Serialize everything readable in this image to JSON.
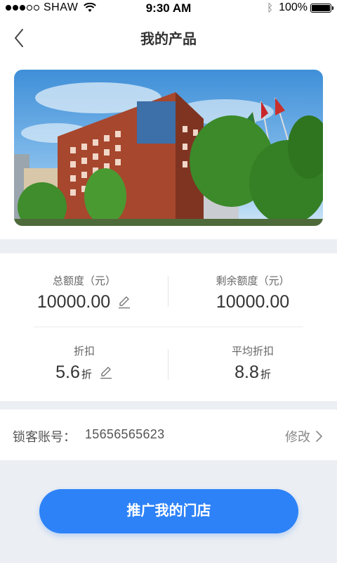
{
  "status_bar": {
    "carrier": "SHAW",
    "time": "9:30 AM",
    "battery": "100%"
  },
  "nav": {
    "title": "我的产品"
  },
  "stats": {
    "total_quota": {
      "label": "总额度（元）",
      "value": "10000.00"
    },
    "remaining_quota": {
      "label": "剩余额度（元）",
      "value": "10000.00"
    },
    "discount": {
      "label": "折扣",
      "value": "5.6",
      "unit": "折"
    },
    "avg_discount": {
      "label": "平均折扣",
      "value": "8.8",
      "unit": "折"
    }
  },
  "account": {
    "label": "锁客账号：",
    "number": "15656565623",
    "modify_label": "修改"
  },
  "promote_button": "推广我的门店",
  "colors": {
    "accent": "#2d82f7",
    "background": "#ebeef3"
  }
}
